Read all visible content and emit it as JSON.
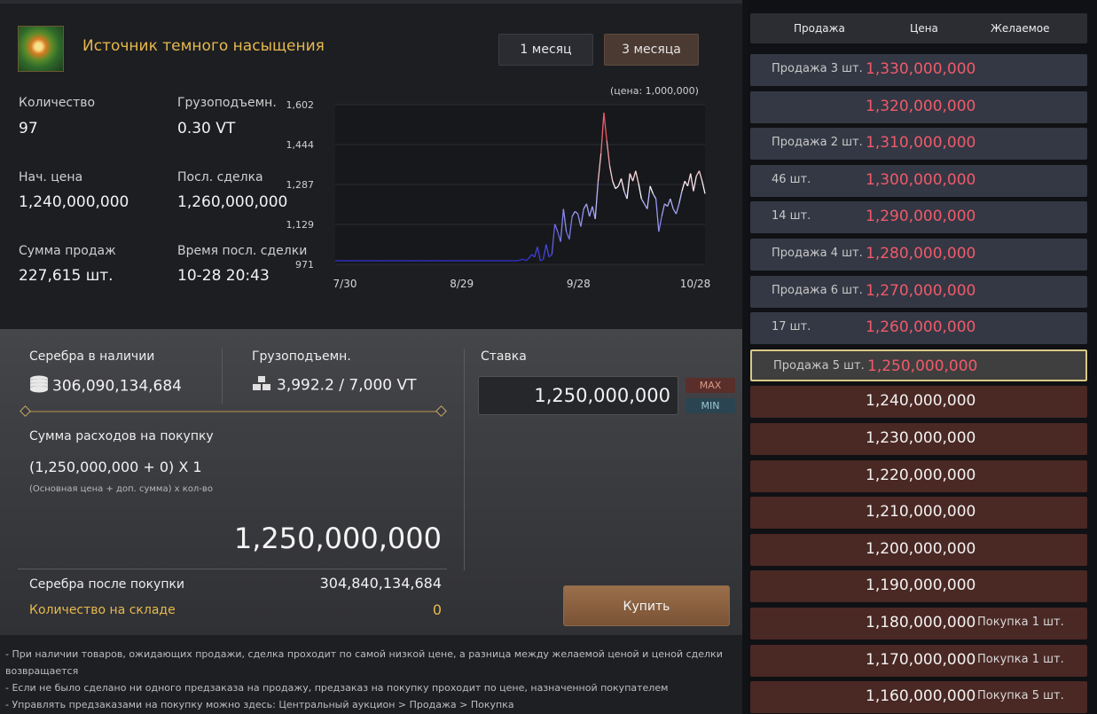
{
  "item": {
    "title": "Источник темного насыщения",
    "periods": [
      "1 месяц",
      "3 месяца"
    ]
  },
  "stats": [
    {
      "label": "Количество",
      "value": "97"
    },
    {
      "label": "Грузоподъемн.",
      "value": "0.30 VT"
    },
    {
      "label": "Нач. цена",
      "value": "1,240,000,000"
    },
    {
      "label": "Посл. сделка",
      "value": "1,260,000,000"
    },
    {
      "label": "Сумма продаж",
      "value": "227,615 шт."
    },
    {
      "label": "Время посл. сделки",
      "value": "10-28 20:43"
    }
  ],
  "chart_data": {
    "type": "line",
    "title": "",
    "unit_note": "(цена: 1,000,000)",
    "xlabel": "",
    "ylabel": "",
    "x_ticks": [
      "7/30",
      "8/29",
      "9/28",
      "10/28"
    ],
    "y_ticks": [
      "1,602",
      "1,444",
      "1,287",
      "1,129",
      "971"
    ],
    "ylim": [
      971,
      1602
    ],
    "series": [
      {
        "values": [
          985,
          985,
          985,
          985,
          985,
          985,
          985,
          985,
          985,
          985,
          985,
          985,
          985,
          985,
          985,
          985,
          985,
          985,
          985,
          985,
          985,
          985,
          985,
          985,
          985,
          985,
          985,
          985,
          985,
          985,
          985,
          985,
          985,
          985,
          985,
          985,
          985,
          985,
          985,
          985,
          985,
          985,
          985,
          985,
          985,
          985,
          985,
          985,
          985,
          985,
          985,
          985,
          985,
          985,
          985,
          985,
          985,
          985,
          985,
          985,
          985,
          985,
          985,
          985,
          988,
          992,
          985,
          995,
          1010,
          1000,
          1040,
          985,
          990,
          1050,
          1000,
          1010,
          1130,
          1100,
          1060,
          1190,
          1100,
          1070,
          1160,
          1180,
          1170,
          1120,
          1190,
          1210,
          1160,
          1200,
          1150,
          1300,
          1410,
          1570,
          1460,
          1360,
          1300,
          1270,
          1280,
          1310,
          1260,
          1230,
          1330,
          1300,
          1340,
          1290,
          1230,
          1210,
          1190,
          1280,
          1250,
          1230,
          1100,
          1160,
          1210,
          1200,
          1230,
          1190,
          1170,
          1210,
          1260,
          1300,
          1280,
          1330,
          1260,
          1320,
          1340,
          1300,
          1250
        ]
      }
    ],
    "grid": true,
    "color_scale": [
      "#2a2ad0",
      "#ffffff",
      "#e02030"
    ]
  },
  "wallet": {
    "silver_label": "Серебра в наличии",
    "silver_value": "306,090,134,684",
    "weight_label": "Грузоподъемн.",
    "weight_value": "3,992.2 / 7,000 VT"
  },
  "bid": {
    "label": "Ставка",
    "value": "1,250,000,000",
    "max": "MAX",
    "min": "MIN"
  },
  "cost": {
    "label": "Сумма расходов на покупку",
    "formula": "(1,250,000,000 + 0) X 1",
    "formula_note": "(Основная цена + доп. сумма) x кол-во",
    "total": "1,250,000,000",
    "after_label": "Серебра после покупки",
    "after_value": "304,840,134,684",
    "storage_label": "Количество на складе",
    "storage_value": "0"
  },
  "buy_button": "Купить",
  "notes": [
    "- При наличии товаров, ожидающих продажи, сделка проходит по самой низкой цене, а разница между желаемой ценой и ценой сделки возвращается",
    "- Если не было сделано ни одного предзаказа на продажу, предзаказ на покупку проходит по цене, назначенной покупателем",
    "- Управлять предзаказами на покупку можно здесь: Центральный аукцион > Продажа > Покупка"
  ],
  "orderbook": {
    "headers": [
      "Продажа",
      "Цена",
      "Желаемое"
    ],
    "rows": [
      {
        "left": "Продажа 3 шт.",
        "price": "1,330,000,000",
        "right": "",
        "kind": "sell"
      },
      {
        "left": "",
        "price": "1,320,000,000",
        "right": "",
        "kind": "sell"
      },
      {
        "left": "Продажа 2 шт.",
        "price": "1,310,000,000",
        "right": "",
        "kind": "sell"
      },
      {
        "left": "46 шт.",
        "price": "1,300,000,000",
        "right": "",
        "kind": "sell"
      },
      {
        "left": "14 шт.",
        "price": "1,290,000,000",
        "right": "",
        "kind": "sell"
      },
      {
        "left": "Продажа 4 шт.",
        "price": "1,280,000,000",
        "right": "",
        "kind": "sell"
      },
      {
        "left": "Продажа 6 шт.",
        "price": "1,270,000,000",
        "right": "",
        "kind": "sell"
      },
      {
        "left": "17 шт.",
        "price": "1,260,000,000",
        "right": "",
        "kind": "sell"
      },
      {
        "left": "Продажа 5 шт.",
        "price": "1,250,000,000",
        "right": "",
        "kind": "selected"
      },
      {
        "left": "",
        "price": "1,240,000,000",
        "right": "",
        "kind": "buy"
      },
      {
        "left": "",
        "price": "1,230,000,000",
        "right": "",
        "kind": "buy"
      },
      {
        "left": "",
        "price": "1,220,000,000",
        "right": "",
        "kind": "buy"
      },
      {
        "left": "",
        "price": "1,210,000,000",
        "right": "",
        "kind": "buy"
      },
      {
        "left": "",
        "price": "1,200,000,000",
        "right": "",
        "kind": "buy"
      },
      {
        "left": "",
        "price": "1,190,000,000",
        "right": "",
        "kind": "buy"
      },
      {
        "left": "",
        "price": "1,180,000,000",
        "right": "Покупка 1 шт.",
        "kind": "buy"
      },
      {
        "left": "",
        "price": "1,170,000,000",
        "right": "Покупка 1 шт.",
        "kind": "buy"
      },
      {
        "left": "",
        "price": "1,160,000,000",
        "right": "Покупка 5 шт.",
        "kind": "buy"
      }
    ]
  }
}
